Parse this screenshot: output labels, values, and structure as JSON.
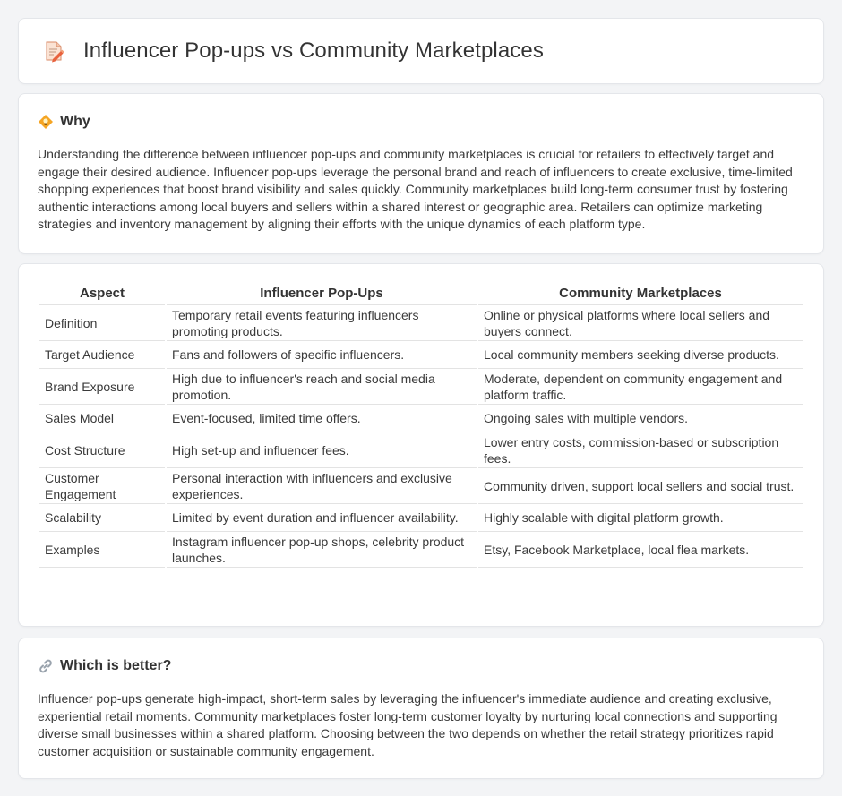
{
  "header": {
    "title": "Influencer Pop-ups vs Community Marketplaces",
    "icon": "edit-note-icon"
  },
  "why": {
    "title": "Why",
    "icon": "lightbulb-icon",
    "text": "Understanding the difference between influencer pop-ups and community marketplaces is crucial for retailers to effectively target and engage their desired audience. Influencer pop-ups leverage the personal brand and reach of influencers to create exclusive, time-limited shopping experiences that boost brand visibility and sales quickly. Community marketplaces build long-term consumer trust by fostering authentic interactions among local buyers and sellers within a shared interest or geographic area. Retailers can optimize marketing strategies and inventory management by aligning their efforts with the unique dynamics of each platform type."
  },
  "table": {
    "headers": [
      "Aspect",
      "Influencer Pop-Ups",
      "Community Marketplaces"
    ],
    "rows": [
      [
        "Definition",
        "Temporary retail events featuring influencers promoting products.",
        "Online or physical platforms where local sellers and buyers connect."
      ],
      [
        "Target Audience",
        "Fans and followers of specific influencers.",
        "Local community members seeking diverse products."
      ],
      [
        "Brand Exposure",
        "High due to influencer's reach and social media promotion.",
        "Moderate, dependent on community engagement and platform traffic."
      ],
      [
        "Sales Model",
        "Event-focused, limited time offers.",
        "Ongoing sales with multiple vendors."
      ],
      [
        "Cost Structure",
        "High set-up and influencer fees.",
        "Lower entry costs, commission-based or subscription fees."
      ],
      [
        "Customer Engagement",
        "Personal interaction with influencers and exclusive experiences.",
        "Community driven, support local sellers and social trust."
      ],
      [
        "Scalability",
        "Limited by event duration and influencer availability.",
        "Highly scalable with digital platform growth."
      ],
      [
        "Examples",
        "Instagram influencer pop-up shops, celebrity product launches.",
        "Etsy, Facebook Marketplace, local flea markets."
      ]
    ]
  },
  "better": {
    "title": "Which is better?",
    "icon": "link-icon",
    "text": "Influencer pop-ups generate high-impact, short-term sales by leveraging the influencer's immediate audience and creating exclusive, experiential retail moments. Community marketplaces foster long-term customer loyalty by nurturing local connections and supporting diverse small businesses within a shared platform. Choosing between the two depends on whether the retail strategy prioritizes rapid customer acquisition or sustainable community engagement."
  }
}
